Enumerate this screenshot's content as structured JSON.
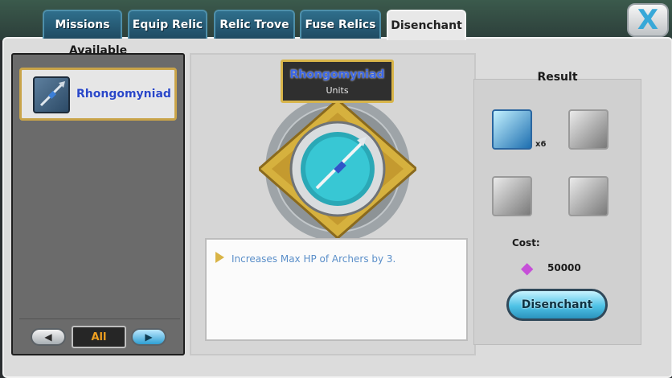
{
  "tabs": [
    "Missions",
    "Equip Relic",
    "Relic Trove",
    "Fuse Relics",
    "Disenchant"
  ],
  "active_tab": "Disenchant",
  "close_label": "X",
  "available_label": "Available",
  "relic_list": [
    {
      "name": "Rhongomyniad"
    }
  ],
  "filter": {
    "label": "All"
  },
  "selected_relic": {
    "name": "Rhongomyniad",
    "category": "Units",
    "description": "Increases Max HP of Archers by 3."
  },
  "result": {
    "label": "Result",
    "quantity_label": "x6"
  },
  "cost": {
    "label": "Cost:",
    "value": "50000"
  },
  "action_button": "Disenchant",
  "colors": {
    "tab_blue": "#2f6f8c",
    "gold": "#d8b54a",
    "relic_name_blue": "#3b66e6",
    "button_cyan": "#4ec2e6"
  }
}
